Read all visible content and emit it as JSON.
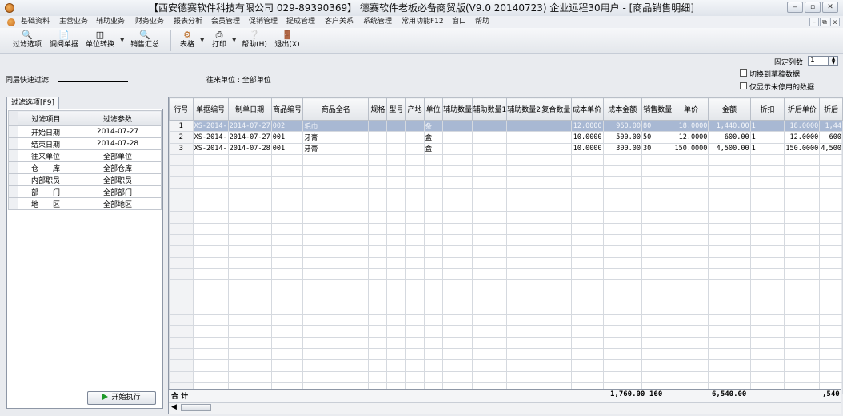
{
  "window": {
    "title": "【西安德赛软件科技有限公司 029-89390369】 德赛软件老板必备商贸版(V9.0 20140723) 企业远程30用户 - [商品销售明细]",
    "min": "‒",
    "max": "▫",
    "close": "✕"
  },
  "menu": [
    "基础资料",
    "主营业务",
    "辅助业务",
    "财务业务",
    "报表分析",
    "会员管理",
    "促销管理",
    "提成管理",
    "客户关系",
    "系统管理",
    "常用功能F12",
    "窗口",
    "帮助"
  ],
  "mdi": {
    "min": "–",
    "restore": "⧉",
    "close": "x"
  },
  "toolbar": {
    "filter": "过滤选项",
    "view_doc": "调阅单据",
    "unit_convert": "单位转换",
    "sales_summary": "销售汇总",
    "table": "表格",
    "print": "打印",
    "help": "帮助(H)",
    "exit": "退出(X)"
  },
  "filterbar": {
    "fixed_cols_label": "固定列数",
    "fixed_cols_value": "1",
    "switch_draft": "切换到草稿数据",
    "show_disabled": "仅显示未停用的数据",
    "quick_filter_label": "同层快速过滤:",
    "contact_label": "往来单位 : 全部单位"
  },
  "left_panel": {
    "tab": "过滤选项[F9]",
    "headers": [
      "过滤项目",
      "过滤参数"
    ],
    "rows": [
      [
        "开始日期",
        "2014-07-27"
      ],
      [
        "结束日期",
        "2014-07-28"
      ],
      [
        "往来单位",
        "全部单位"
      ],
      [
        "仓　　库",
        "全部仓库"
      ],
      [
        "内部职员",
        "全部职员"
      ],
      [
        "部　　门",
        "全部部门"
      ],
      [
        "地　　区",
        "全部地区"
      ]
    ],
    "run_button": "开始执行"
  },
  "grid": {
    "headers": [
      "行号",
      "单据编号",
      "制单日期",
      "商品编号",
      "商品全名",
      "规格",
      "型号",
      "产地",
      "单位",
      "辅助数量",
      "辅助数量1",
      "辅助数量2",
      "复合数量",
      "成本单价",
      "成本金额",
      "销售数量",
      "单价",
      "金额",
      "折扣",
      "折后单价",
      "折后"
    ],
    "rows": [
      [
        "1",
        "XS-2014-",
        "2014-07-27",
        "002",
        "毛巾",
        "",
        "",
        "",
        "条",
        "",
        "",
        "",
        "",
        "12.0000",
        "960.00",
        "80",
        "18.0000",
        "1,440.00",
        "1",
        "18.0000",
        "1,44"
      ],
      [
        "2",
        "XS-2014-",
        "2014-07-27",
        "001",
        "牙膏",
        "",
        "",
        "",
        "盒",
        "",
        "",
        "",
        "",
        "10.0000",
        "500.00",
        "50",
        "12.0000",
        "600.00",
        "1",
        "12.0000",
        "600"
      ],
      [
        "3",
        "XS-2014-",
        "2014-07-28",
        "001",
        "牙膏",
        "",
        "",
        "",
        "盒",
        "",
        "",
        "",
        "",
        "10.0000",
        "300.00",
        "30",
        "150.0000",
        "4,500.00",
        "1",
        "150.0000",
        "4,500"
      ]
    ],
    "selected_row": 1,
    "totals": {
      "label": "合 计",
      "cost_amount": "1,760.00",
      "sales_qty": "160",
      "amount": "6,540.00",
      "discounted": ",540"
    }
  }
}
